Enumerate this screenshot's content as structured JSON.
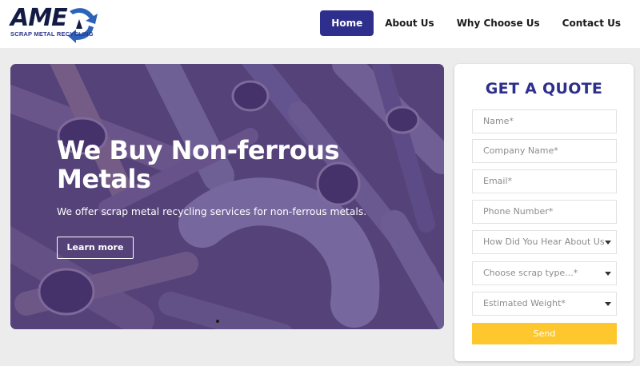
{
  "brand": {
    "logo_text": "AME",
    "logo_subtitle": "SCRAP METAL RECYCLING",
    "logo_icon": "recycle-arrows-icon",
    "colors": {
      "primary": "#2e2f8c",
      "accent": "#fec72e",
      "logo_dark": "#131a44"
    }
  },
  "nav": {
    "items": [
      {
        "label": "Home",
        "active": true
      },
      {
        "label": "About Us",
        "active": false
      },
      {
        "label": "Why Choose Us",
        "active": false
      },
      {
        "label": "Contact Us",
        "active": false
      }
    ]
  },
  "hero": {
    "title": "We Buy Non-ferrous Metals",
    "text": "We offer scrap metal recycling services for non-ferrous metals.",
    "button_label": "Learn more"
  },
  "quote_form": {
    "title": "GET A QUOTE",
    "fields": [
      {
        "placeholder": "Name*",
        "type": "text"
      },
      {
        "placeholder": "Company Name*",
        "type": "text"
      },
      {
        "placeholder": "Email*",
        "type": "text"
      },
      {
        "placeholder": "Phone Number*",
        "type": "text"
      },
      {
        "placeholder": "How Did You Hear About Us",
        "type": "select",
        "icon": "chevron-down-icon"
      },
      {
        "placeholder": "Choose scrap type...*",
        "type": "select",
        "icon": "chevron-down-icon"
      },
      {
        "placeholder": "Estimated Weight*",
        "type": "select",
        "icon": "chevron-down-icon"
      }
    ],
    "submit_label": "Send"
  }
}
